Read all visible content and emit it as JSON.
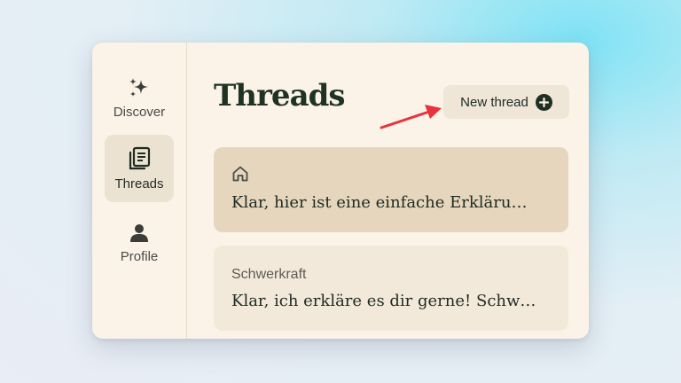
{
  "sidebar": {
    "items": [
      {
        "label": "Discover",
        "icon": "sparkle-icon",
        "active": false
      },
      {
        "label": "Threads",
        "icon": "threads-icon",
        "active": true
      },
      {
        "label": "Profile",
        "icon": "person-icon",
        "active": false
      }
    ]
  },
  "main": {
    "title": "Threads",
    "new_thread_label": "New thread",
    "threads": [
      {
        "title": "",
        "icon": "home-icon",
        "preview": "Klar, hier ist eine einfache Erkläru…"
      },
      {
        "title": "Schwerkraft",
        "preview": "Klar, ich erkläre es dir gerne! Schw…"
      }
    ]
  },
  "colors": {
    "window_bg": "#fbf3e8",
    "active_card": "#e5d6bd",
    "accent_dark": "#1f2d22",
    "annotation_arrow": "#e8323c"
  }
}
